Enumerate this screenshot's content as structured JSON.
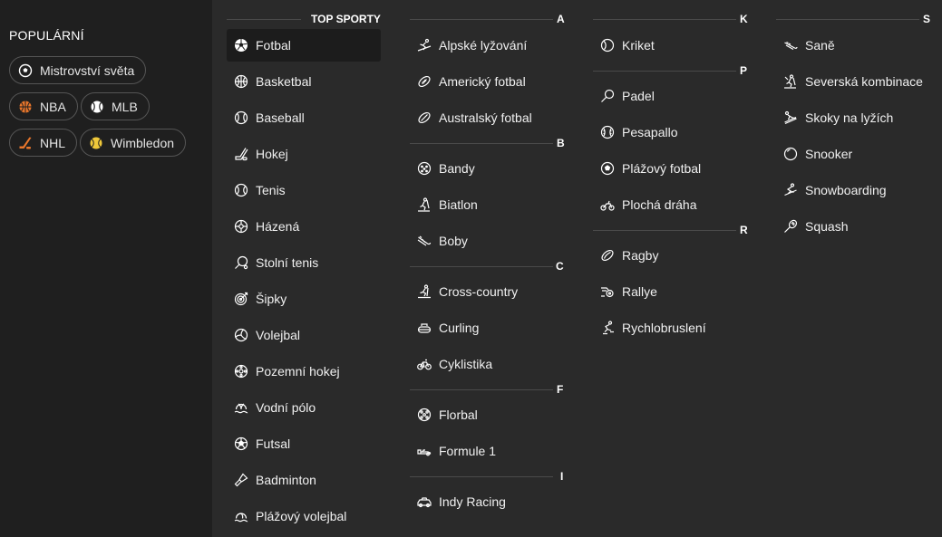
{
  "popular": {
    "title": "POPULÁRNÍ",
    "chips": [
      {
        "label": "Mistrovství světa",
        "icon": "soccer-ball-icon",
        "color": "#ffffff"
      },
      {
        "label": "NBA",
        "icon": "basketball-icon",
        "color": "#e8762b"
      },
      {
        "label": "MLB",
        "icon": "baseball-icon",
        "color": "#ffffff"
      },
      {
        "label": "NHL",
        "icon": "hockey-stick-icon",
        "color": "#e8762b"
      },
      {
        "label": "Wimbledon",
        "icon": "tennis-ball-icon",
        "color": "#f0c93a"
      }
    ]
  },
  "top": {
    "header": "TOP SPORTY",
    "items": [
      "Fotbal",
      "Basketbal",
      "Baseball",
      "Hokej",
      "Tenis",
      "Házená",
      "Stolní tenis",
      "Šipky",
      "Volejbal",
      "Pozemní hokej",
      "Vodní pólo",
      "Futsal",
      "Badminton",
      "Plážový volejbal"
    ]
  },
  "col2": {
    "A": {
      "letter": "A",
      "items": [
        "Alpské lyžování",
        "Americký fotbal",
        "Australský fotbal"
      ]
    },
    "B": {
      "letter": "B",
      "items": [
        "Bandy",
        "Biatlon",
        "Boby"
      ]
    },
    "C": {
      "letter": "C",
      "items": [
        "Cross-country",
        "Curling",
        "Cyklistika"
      ]
    },
    "F": {
      "letter": "F",
      "items": [
        "Florbal",
        "Formule 1"
      ]
    },
    "I": {
      "letter": "I",
      "items": [
        "Indy Racing"
      ]
    }
  },
  "col3": {
    "K": {
      "letter": "K",
      "items": [
        "Kriket"
      ]
    },
    "P": {
      "letter": "P",
      "items": [
        "Padel",
        "Pesapallo",
        "Plážový fotbal",
        "Plochá dráha"
      ]
    },
    "R": {
      "letter": "R",
      "items": [
        "Ragby",
        "Rallye",
        "Rychlobruslení"
      ]
    }
  },
  "col4": {
    "S": {
      "letter": "S",
      "items": [
        "Saně",
        "Severská kombinace",
        "Skoky na lyžích",
        "Snooker",
        "Snowboarding",
        "Squash"
      ]
    }
  },
  "colors": {
    "sidebar_bg": "#1f1f1f",
    "main_bg": "#2a2a2a",
    "active_bg": "#1c1c1c",
    "divider": "#4a4a4a"
  }
}
